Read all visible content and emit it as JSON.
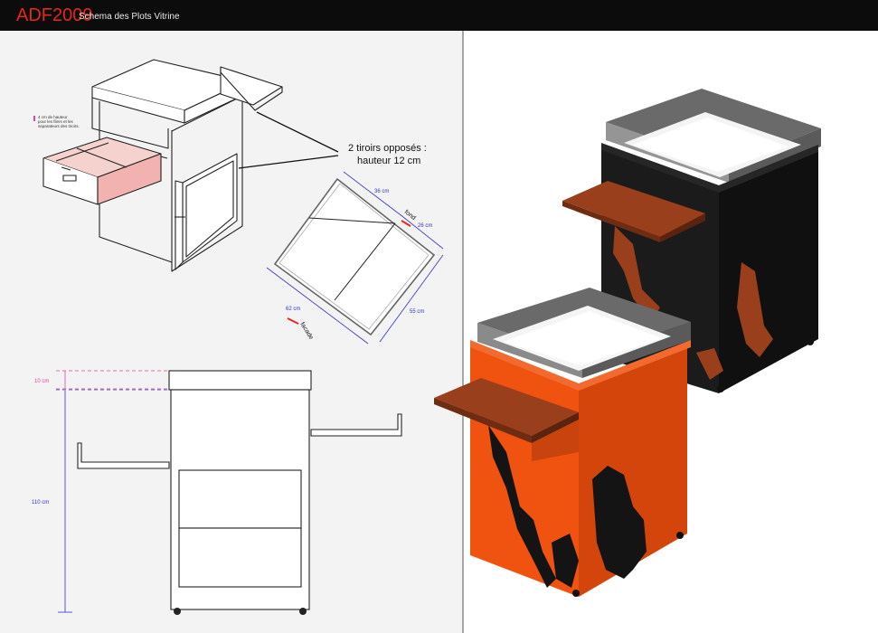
{
  "header": {
    "brand": "ADF2009",
    "subtitle": "Schema des Plots Vitrine"
  },
  "colors": {
    "header_bg": "#0c0c0c",
    "brand_red": "#e8261b",
    "orange_body": "#f0520f",
    "black_body": "#141414",
    "drawer_brown": "#9a3f1c",
    "dimension_blue": "#3333cc",
    "dimension_pink": "#e0449c",
    "highlight_pink": "#f2b3b0"
  },
  "annotations": {
    "note_line1": "4 cm de hauteur",
    "note_line2": "pour les filers et les",
    "note_line3": "separateurs des tiroirs.",
    "drawers_line1": "2 tiroirs opposés :",
    "drawers_line2": "hauteur 12 cm"
  },
  "dimensions": {
    "d36": "36 cm",
    "d26": "26 cm",
    "d62": "62 cm",
    "d55": "55 cm",
    "fond": "fond",
    "facade": "facade",
    "d10": "10 cm",
    "d110": "110 cm"
  }
}
